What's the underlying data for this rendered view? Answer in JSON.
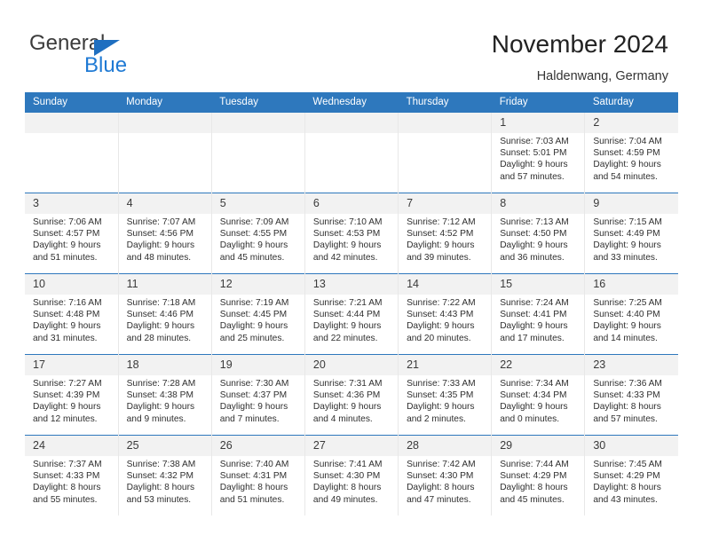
{
  "brand": {
    "name_top": "General",
    "name_bottom": "Blue",
    "triangle_icon": "blue-triangle-icon",
    "color_top": "#3b3b3b",
    "color_bottom": "#1f7ad4"
  },
  "header": {
    "title": "November 2024",
    "subtitle": "Haldenwang, Germany"
  },
  "theme": {
    "header_bg": "#2e78bd",
    "header_text": "#ffffff",
    "daynum_bg": "#f2f2f2",
    "cell_bg": "#ffffff",
    "row_rule": "#2e78bd"
  },
  "calendar": {
    "weekday_headers": [
      "Sunday",
      "Monday",
      "Tuesday",
      "Wednesday",
      "Thursday",
      "Friday",
      "Saturday"
    ],
    "weeks": [
      [
        {
          "day": "",
          "lines": []
        },
        {
          "day": "",
          "lines": []
        },
        {
          "day": "",
          "lines": []
        },
        {
          "day": "",
          "lines": []
        },
        {
          "day": "",
          "lines": []
        },
        {
          "day": "1",
          "lines": [
            "Sunrise: 7:03 AM",
            "Sunset: 5:01 PM",
            "Daylight: 9 hours",
            "and 57 minutes."
          ]
        },
        {
          "day": "2",
          "lines": [
            "Sunrise: 7:04 AM",
            "Sunset: 4:59 PM",
            "Daylight: 9 hours",
            "and 54 minutes."
          ]
        }
      ],
      [
        {
          "day": "3",
          "lines": [
            "Sunrise: 7:06 AM",
            "Sunset: 4:57 PM",
            "Daylight: 9 hours",
            "and 51 minutes."
          ]
        },
        {
          "day": "4",
          "lines": [
            "Sunrise: 7:07 AM",
            "Sunset: 4:56 PM",
            "Daylight: 9 hours",
            "and 48 minutes."
          ]
        },
        {
          "day": "5",
          "lines": [
            "Sunrise: 7:09 AM",
            "Sunset: 4:55 PM",
            "Daylight: 9 hours",
            "and 45 minutes."
          ]
        },
        {
          "day": "6",
          "lines": [
            "Sunrise: 7:10 AM",
            "Sunset: 4:53 PM",
            "Daylight: 9 hours",
            "and 42 minutes."
          ]
        },
        {
          "day": "7",
          "lines": [
            "Sunrise: 7:12 AM",
            "Sunset: 4:52 PM",
            "Daylight: 9 hours",
            "and 39 minutes."
          ]
        },
        {
          "day": "8",
          "lines": [
            "Sunrise: 7:13 AM",
            "Sunset: 4:50 PM",
            "Daylight: 9 hours",
            "and 36 minutes."
          ]
        },
        {
          "day": "9",
          "lines": [
            "Sunrise: 7:15 AM",
            "Sunset: 4:49 PM",
            "Daylight: 9 hours",
            "and 33 minutes."
          ]
        }
      ],
      [
        {
          "day": "10",
          "lines": [
            "Sunrise: 7:16 AM",
            "Sunset: 4:48 PM",
            "Daylight: 9 hours",
            "and 31 minutes."
          ]
        },
        {
          "day": "11",
          "lines": [
            "Sunrise: 7:18 AM",
            "Sunset: 4:46 PM",
            "Daylight: 9 hours",
            "and 28 minutes."
          ]
        },
        {
          "day": "12",
          "lines": [
            "Sunrise: 7:19 AM",
            "Sunset: 4:45 PM",
            "Daylight: 9 hours",
            "and 25 minutes."
          ]
        },
        {
          "day": "13",
          "lines": [
            "Sunrise: 7:21 AM",
            "Sunset: 4:44 PM",
            "Daylight: 9 hours",
            "and 22 minutes."
          ]
        },
        {
          "day": "14",
          "lines": [
            "Sunrise: 7:22 AM",
            "Sunset: 4:43 PM",
            "Daylight: 9 hours",
            "and 20 minutes."
          ]
        },
        {
          "day": "15",
          "lines": [
            "Sunrise: 7:24 AM",
            "Sunset: 4:41 PM",
            "Daylight: 9 hours",
            "and 17 minutes."
          ]
        },
        {
          "day": "16",
          "lines": [
            "Sunrise: 7:25 AM",
            "Sunset: 4:40 PM",
            "Daylight: 9 hours",
            "and 14 minutes."
          ]
        }
      ],
      [
        {
          "day": "17",
          "lines": [
            "Sunrise: 7:27 AM",
            "Sunset: 4:39 PM",
            "Daylight: 9 hours",
            "and 12 minutes."
          ]
        },
        {
          "day": "18",
          "lines": [
            "Sunrise: 7:28 AM",
            "Sunset: 4:38 PM",
            "Daylight: 9 hours",
            "and 9 minutes."
          ]
        },
        {
          "day": "19",
          "lines": [
            "Sunrise: 7:30 AM",
            "Sunset: 4:37 PM",
            "Daylight: 9 hours",
            "and 7 minutes."
          ]
        },
        {
          "day": "20",
          "lines": [
            "Sunrise: 7:31 AM",
            "Sunset: 4:36 PM",
            "Daylight: 9 hours",
            "and 4 minutes."
          ]
        },
        {
          "day": "21",
          "lines": [
            "Sunrise: 7:33 AM",
            "Sunset: 4:35 PM",
            "Daylight: 9 hours",
            "and 2 minutes."
          ]
        },
        {
          "day": "22",
          "lines": [
            "Sunrise: 7:34 AM",
            "Sunset: 4:34 PM",
            "Daylight: 9 hours",
            "and 0 minutes."
          ]
        },
        {
          "day": "23",
          "lines": [
            "Sunrise: 7:36 AM",
            "Sunset: 4:33 PM",
            "Daylight: 8 hours",
            "and 57 minutes."
          ]
        }
      ],
      [
        {
          "day": "24",
          "lines": [
            "Sunrise: 7:37 AM",
            "Sunset: 4:33 PM",
            "Daylight: 8 hours",
            "and 55 minutes."
          ]
        },
        {
          "day": "25",
          "lines": [
            "Sunrise: 7:38 AM",
            "Sunset: 4:32 PM",
            "Daylight: 8 hours",
            "and 53 minutes."
          ]
        },
        {
          "day": "26",
          "lines": [
            "Sunrise: 7:40 AM",
            "Sunset: 4:31 PM",
            "Daylight: 8 hours",
            "and 51 minutes."
          ]
        },
        {
          "day": "27",
          "lines": [
            "Sunrise: 7:41 AM",
            "Sunset: 4:30 PM",
            "Daylight: 8 hours",
            "and 49 minutes."
          ]
        },
        {
          "day": "28",
          "lines": [
            "Sunrise: 7:42 AM",
            "Sunset: 4:30 PM",
            "Daylight: 8 hours",
            "and 47 minutes."
          ]
        },
        {
          "day": "29",
          "lines": [
            "Sunrise: 7:44 AM",
            "Sunset: 4:29 PM",
            "Daylight: 8 hours",
            "and 45 minutes."
          ]
        },
        {
          "day": "30",
          "lines": [
            "Sunrise: 7:45 AM",
            "Sunset: 4:29 PM",
            "Daylight: 8 hours",
            "and 43 minutes."
          ]
        }
      ]
    ]
  }
}
